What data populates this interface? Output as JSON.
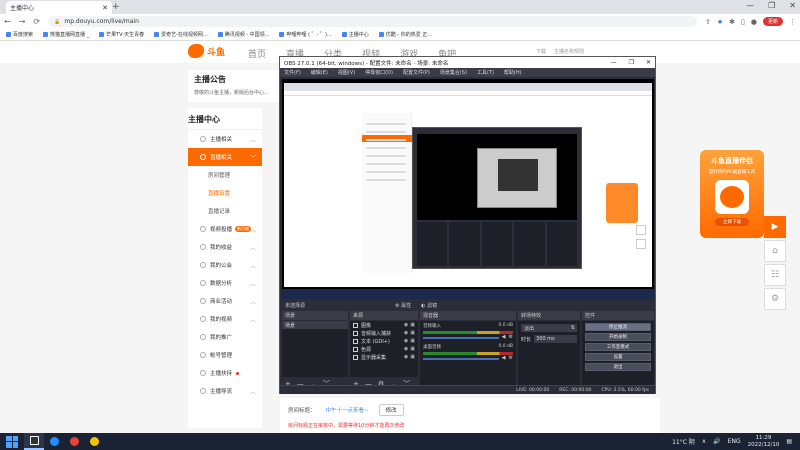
{
  "browser": {
    "tab_title": "主播中心",
    "new_tab": "+",
    "window_controls": [
      "—",
      "❐",
      "✕"
    ],
    "url": "mp.douyu.com/live/main",
    "nav": [
      "←",
      "→",
      "⟳",
      "🔒"
    ],
    "profile_label": "更新",
    "bookmarks": [
      "百度搜索",
      "熊猫直播网直播 _",
      "芒果TV-天生青春",
      "爱奇艺-在线视频网...",
      "腾讯视频 - 中国领...",
      "哔哩哔哩 ( ゜- ゜)...",
      "主播中心",
      "优酷 - 你的热爱 正..."
    ]
  },
  "site": {
    "logo_text": "斗鱼",
    "logo_sub": "DOUYU.COM",
    "nav": [
      "首页",
      "直播",
      "分类",
      "视频",
      "游戏",
      "鱼吧"
    ],
    "user_links": [
      "下载",
      "主播名称规则"
    ],
    "announce_title": "主播公告",
    "announce_text": "尊敬的斗鱼主播，新版后台中心..."
  },
  "sidebar": {
    "title": "主播中心",
    "items": [
      {
        "label": "主播相关",
        "chevron": "︿",
        "type": "item"
      },
      {
        "label": "直播相关",
        "chevron": "﹀",
        "type": "item",
        "active": true
      },
      {
        "label": "房间管理",
        "type": "sub"
      },
      {
        "label": "直播设置",
        "type": "sub",
        "selected": true
      },
      {
        "label": "直播记录",
        "type": "sub"
      },
      {
        "label": "视频投播",
        "chevron": "︿",
        "type": "item",
        "badge": "新功能"
      },
      {
        "label": "我的收益",
        "chevron": "︿",
        "type": "item"
      },
      {
        "label": "我的公会",
        "chevron": "︿",
        "type": "item"
      },
      {
        "label": "数据分析",
        "chevron": "︿",
        "type": "item"
      },
      {
        "label": "商业活动",
        "chevron": "︿",
        "type": "item"
      },
      {
        "label": "我的视频",
        "chevron": "︿",
        "type": "item"
      },
      {
        "label": "我的推广",
        "type": "item"
      },
      {
        "label": "帐号管理",
        "type": "item"
      },
      {
        "label": "主播扶持",
        "type": "item",
        "dot": true
      },
      {
        "label": "主播导流",
        "chevron": "︿",
        "type": "item"
      }
    ]
  },
  "promo": {
    "title": "斗鱼直播伴侣",
    "subtitle": "超好用的PC端直播工具",
    "button": "立即下载"
  },
  "sidetools": [
    "▶",
    "⌂",
    "☷",
    "⚙"
  ],
  "room": {
    "label": "房间标题：",
    "value": "中午十一点来看~",
    "edit": "修改",
    "warning": "房间标题正在审核中，需要等待10分钟才能再次修改"
  },
  "obs": {
    "title": "OBS 27.0.1 (64-bit, windows) - 配置文件: 未命名 - 场景: 未命名",
    "controls": [
      "—",
      "❐",
      "✕"
    ],
    "menu": [
      "文件(F)",
      "编辑(E)",
      "视图(V)",
      "停靠窗口(D)",
      "配置文件(P)",
      "场景集合(S)",
      "工具(T)",
      "帮助(H)"
    ],
    "nested_url": "mp.douyu.com/live/main",
    "no_source": "未选择源",
    "props": "属性",
    "filters": "滤镜",
    "docks": {
      "scenes": {
        "title": "场景",
        "items": [
          "场景"
        ]
      },
      "sources": {
        "title": "来源",
        "items": [
          "图像",
          "音频输入捕获",
          "文本 (GDI+)",
          "色源",
          "显示器采集"
        ]
      },
      "mixer": {
        "title": "混音器",
        "channels": [
          {
            "name": "音频输入",
            "db": "0.0 dB"
          },
          {
            "name": "桌面音频",
            "db": "0.0 dB"
          }
        ]
      },
      "transitions": {
        "title": "转场特效",
        "fade": "淡出",
        "duration_label": "时长",
        "duration": "300 ms"
      },
      "controls": {
        "title": "控件",
        "buttons": [
          "停止推流",
          "开始录制",
          "工作室模式",
          "设置",
          "退出"
        ]
      }
    },
    "footer_icons": [
      "+",
      "—",
      "︿",
      "﹀"
    ],
    "status": [
      "LIVE: 00:00:00",
      "REC: 00:00:00",
      "CPU: 2.5%, 60.00 fps"
    ]
  },
  "taskbar": {
    "apps": [
      "#ffffff",
      "#1e90ff",
      "#ea4335",
      "#f5c400"
    ],
    "weather": "11°C 阴",
    "tray": [
      "∧",
      "🔊",
      "ENG",
      "🔋"
    ],
    "time": "11:29",
    "date": "2022/12/10"
  }
}
